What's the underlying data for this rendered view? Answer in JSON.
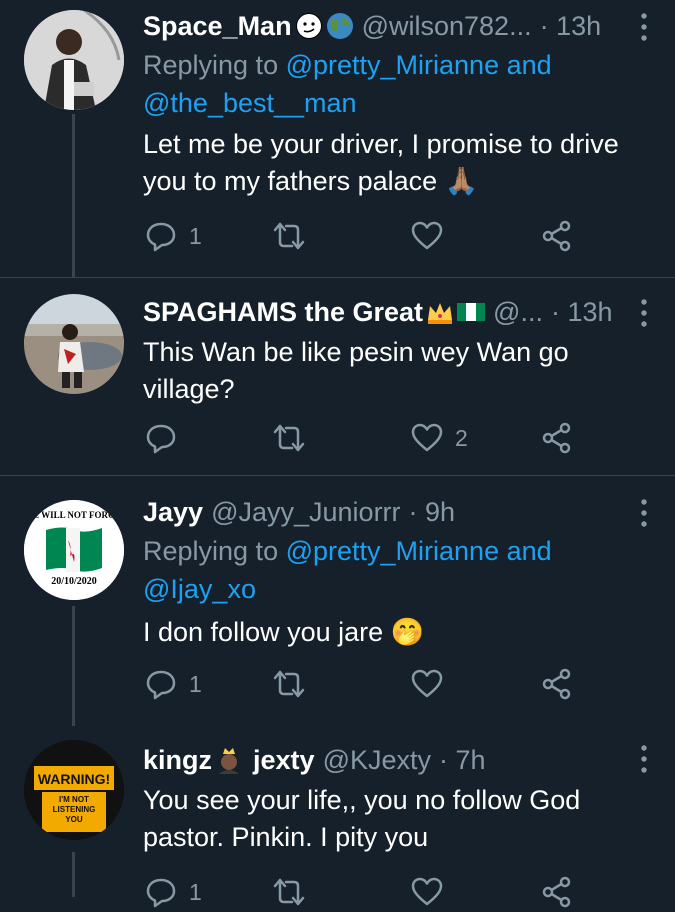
{
  "tweets": [
    {
      "name": "Space_Man",
      "handle": "@wilson782...",
      "time": "· 13h",
      "replying_prefix": "Replying to ",
      "replying_links": "@pretty_Mirianne and",
      "replying_links2": "@the_best__man",
      "text_line1": "Let me be your driver, I promise to drive",
      "text_line2": "you to my fathers palace 🙏🏽",
      "reply_count": "1",
      "retweet_count": "",
      "like_count": ""
    },
    {
      "name": "SPAGHAMS the Great",
      "handle": "@...",
      "time": "· 13h",
      "text_line1": "This Wan be like pesin wey Wan go",
      "text_line2": "village?",
      "reply_count": "",
      "retweet_count": "",
      "like_count": "2"
    },
    {
      "name": "Jayy",
      "handle": "@Jayy_Juniorrr",
      "time": "· 9h",
      "avatar_text_top": "E WILL NOT FORG",
      "avatar_text_bottom": "20/10/2020",
      "replying_prefix": "Replying to ",
      "replying_links": "@pretty_Mirianne and",
      "replying_links2": "@Ijay_xo",
      "text_line1": "I don follow you jare 🤭",
      "reply_count": "1",
      "retweet_count": "",
      "like_count": ""
    },
    {
      "name": "kingz",
      "name2": "jexty",
      "handle": "@KJexty",
      "time": "· 7h",
      "avatar_text_top": "WARNING!",
      "avatar_text_mid": "I'M NOT LISTENING YOU",
      "text_line1": "You see your life,, you no follow God",
      "text_line2": "pastor. Pinkin. I pity you",
      "reply_count": "1"
    }
  ],
  "colors": {
    "background": "#15202b",
    "muted": "#8899a6",
    "link": "#1da1f2",
    "divider": "#38444d"
  },
  "icons": [
    "reply-icon",
    "retweet-icon",
    "like-icon",
    "share-icon",
    "more-icon"
  ]
}
